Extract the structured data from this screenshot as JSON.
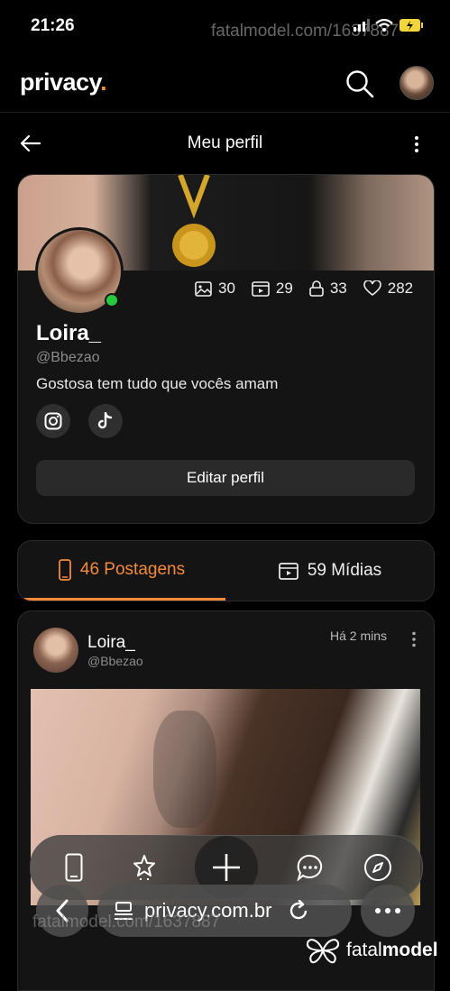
{
  "status_bar": {
    "time": "21:26",
    "watermark": "fatalmodel.com/1637887"
  },
  "app_bar": {
    "logo": "privacy",
    "logo_dot": "."
  },
  "sub_header": {
    "title": "Meu perfil"
  },
  "profile": {
    "stats": {
      "photos": "30",
      "videos": "29",
      "locked": "33",
      "likes": "282"
    },
    "name": "Loira_",
    "handle": "@Bbezao",
    "bio": "Gostosa tem tudo que vocês amam",
    "edit_button": "Editar perfil"
  },
  "tabs": [
    {
      "label": "46 Postagens",
      "active": true
    },
    {
      "label": "59 Mídias",
      "active": false
    }
  ],
  "post": {
    "name": "Loira_",
    "handle": "@Bbezao",
    "time": "Há 2 mins"
  },
  "browser": {
    "url": "privacy.com.br"
  },
  "watermark_bottom": "fatalmodel.com/1637887",
  "brand": {
    "prefix": "fatal",
    "suffix": "model"
  },
  "colors": {
    "accent": "#f58a3a",
    "online": "#27c93f",
    "background": "#000000"
  },
  "icons": [
    "search-icon",
    "back-arrow-icon",
    "kebab-icon",
    "image-icon",
    "video-icon",
    "lock-icon",
    "heart-icon",
    "instagram-icon",
    "tiktok-icon",
    "phone-icon",
    "star-icon",
    "plus-icon",
    "chat-icon",
    "compass-icon",
    "refresh-icon",
    "tabs-icon",
    "more-icon"
  ]
}
